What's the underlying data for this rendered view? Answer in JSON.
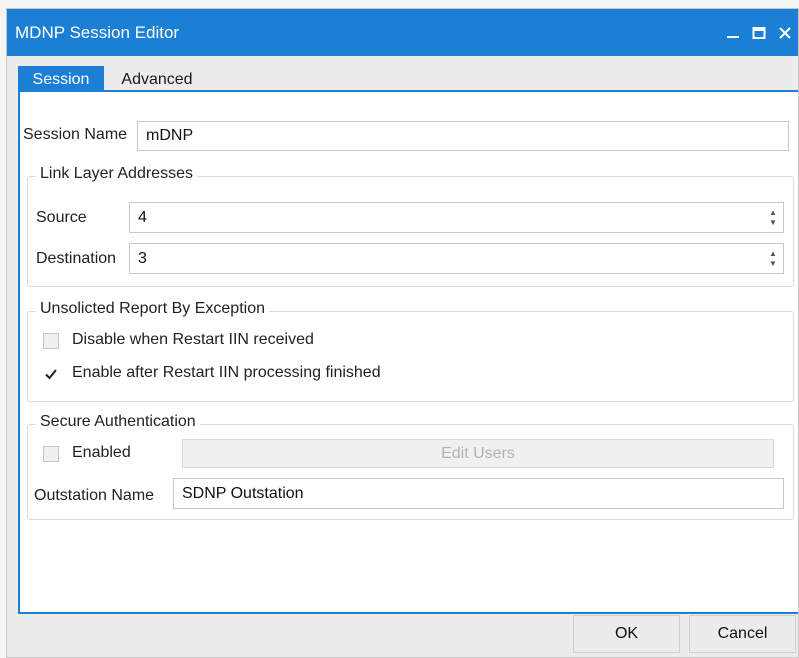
{
  "window": {
    "title": "MDNP Session Editor",
    "accent_color": "#1c7fd6",
    "controls": [
      "minimize-icon",
      "maximize-icon",
      "close-icon"
    ]
  },
  "tabs": [
    {
      "label": "Session",
      "active": true
    },
    {
      "label": "Advanced",
      "active": false
    }
  ],
  "session": {
    "name_label": "Session Name",
    "name_value": "mDNP"
  },
  "link_layer": {
    "title": "Link Layer Addresses",
    "source_label": "Source",
    "source_value": "4",
    "destination_label": "Destination",
    "destination_value": "3"
  },
  "unsolicited": {
    "title": "Unsolicted Report By Exception",
    "disable_label": "Disable when Restart IIN received",
    "disable_checked": false,
    "enable_label": "Enable after Restart IIN processing finished",
    "enable_checked": true
  },
  "secure_auth": {
    "title": "Secure Authentication",
    "enabled_label": "Enabled",
    "enabled_checked": false,
    "edit_users_label": "Edit Users",
    "outstation_label": "Outstation Name",
    "outstation_value": "SDNP Outstation"
  },
  "footer": {
    "ok_label": "OK",
    "cancel_label": "Cancel"
  }
}
